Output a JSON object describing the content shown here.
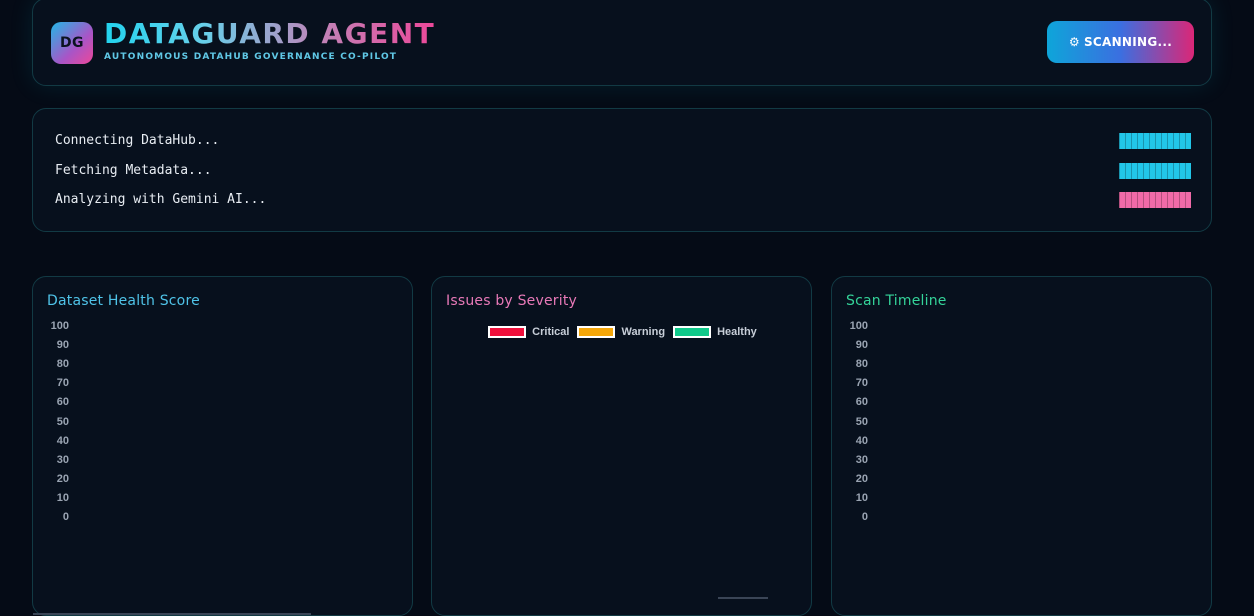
{
  "header": {
    "logo_text": "DG",
    "title": "DATAGUARD AGENT",
    "subtitle": "AUTONOMOUS DATAHUB GOVERNANCE CO-PILOT",
    "scan_button": {
      "icon": "gear-icon",
      "label": "SCANNING...",
      "glyph": "⚙"
    }
  },
  "steps": [
    {
      "label": "Connecting DataHub...",
      "color": "#22c6e8"
    },
    {
      "label": "Fetching Metadata...",
      "color": "#22c6e8"
    },
    {
      "label": "Analyzing with Gemini AI...",
      "color": "#f06aa8"
    }
  ],
  "panels": {
    "health": {
      "title": "Dataset Health Score",
      "title_color": "#4fc3e8"
    },
    "severity": {
      "title": "Issues by Severity",
      "title_color": "#e879b8"
    },
    "timeline": {
      "title": "Scan Timeline",
      "title_color": "#34d399"
    }
  },
  "chart_data": [
    {
      "type": "bar",
      "title": "Dataset Health Score",
      "categories": [],
      "values": [],
      "ylim": [
        0,
        100
      ],
      "yticks": [
        "100",
        "90",
        "80",
        "70",
        "60",
        "50",
        "40",
        "30",
        "20",
        "10",
        "0"
      ]
    },
    {
      "type": "pie",
      "title": "Issues by Severity",
      "legend": [
        {
          "label": "Critical",
          "color": "#f0103c"
        },
        {
          "label": "Warning",
          "color": "#f5a70a"
        },
        {
          "label": "Healthy",
          "color": "#10c98a"
        }
      ],
      "values": [],
      "legend_position": "top"
    },
    {
      "type": "line",
      "title": "Scan Timeline",
      "x": [],
      "values": [],
      "ylim": [
        0,
        100
      ],
      "yticks": [
        "100",
        "90",
        "80",
        "70",
        "60",
        "50",
        "40",
        "30",
        "20",
        "10",
        "0"
      ]
    }
  ]
}
